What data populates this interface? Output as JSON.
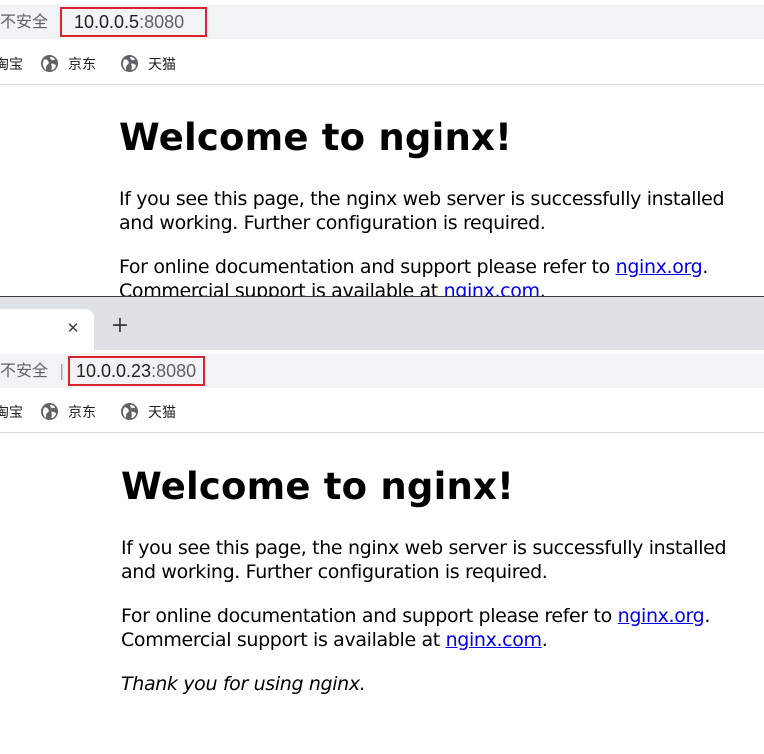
{
  "common": {
    "security_label": "不安全",
    "separator": "|",
    "bookmarks": {
      "first_label": "淘宝",
      "jd_label": "京东",
      "tmall_label": "天猫"
    }
  },
  "top": {
    "url_host": "10.0.0.5",
    "url_port": ":8080"
  },
  "bottom": {
    "tab_close": "✕",
    "new_tab": "+",
    "url_host": "10.0.0.23",
    "url_port": ":8080"
  },
  "nginx": {
    "heading": "Welcome to nginx!",
    "intro": "If you see this page, the nginx web server is successfully installed and working. Further configuration is required.",
    "docs_prefix": "For online documentation and support please refer to ",
    "docs_link": "nginx.org",
    "docs_suffix": ".",
    "commercial_prefix": "Commercial support is available at ",
    "commercial_link": "nginx.com",
    "commercial_suffix": ".",
    "thanks": "Thank you for using nginx."
  },
  "colors": {
    "url_highlight": "#d9232e",
    "link": "#0000ee",
    "toolbar_bg": "#f1f3f4",
    "tabstrip_bg": "#dee1e6"
  },
  "icons": {
    "bookmark": "globe-icon",
    "tab_close": "close-icon",
    "new_tab": "plus-icon"
  }
}
